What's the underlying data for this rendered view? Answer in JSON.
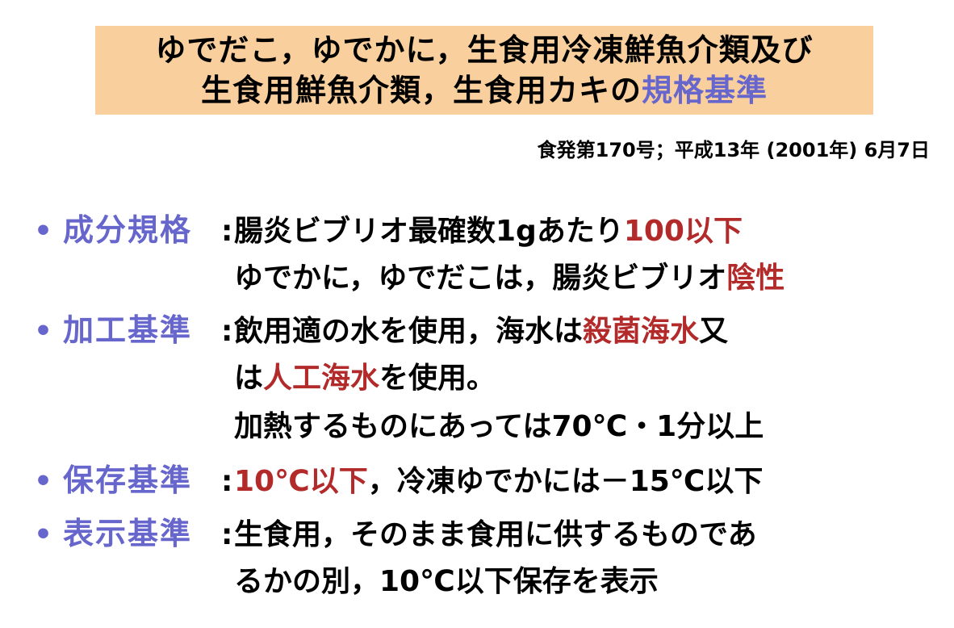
{
  "title": {
    "line1": "ゆでだこ，ゆでかに，生食用冷凍鮮魚介類及び",
    "line2_plain": "生食用鮮魚介類，生食用カキの",
    "line2_highlight": "規格基準"
  },
  "citation": "食発第170号；平成13年 (2001年) 6月7日",
  "bullet_glyph": "•",
  "colon": ":",
  "items": [
    {
      "label": "成分規格",
      "lines": [
        {
          "t1": "腸炎ビブリオ最確数1gあたり",
          "r1": "100以下"
        },
        {
          "t1": "ゆでかに，ゆでだこは，腸炎ビブリオ",
          "r1": "陰性"
        }
      ]
    },
    {
      "label": "加工基準",
      "lines": [
        {
          "t1": "飲用適の水を使用，海水は",
          "r1": "殺菌海水",
          "t2": "又"
        },
        {
          "t1": "は",
          "r1": "人工海水",
          "t2": "を使用。"
        },
        {
          "t1": "加熱するものにあっては70℃・1分以上"
        }
      ]
    },
    {
      "label": "保存基準",
      "lines": [
        {
          "r1": "10℃以下",
          "t2": "，冷凍ゆでかには－15℃以下"
        }
      ]
    },
    {
      "label": "表示基準",
      "lines": [
        {
          "t1": "生食用，そのまま食用に供するものであ"
        },
        {
          "t1": "るかの別，10℃以下保存を表示"
        }
      ]
    }
  ],
  "colors": {
    "title_bg": "#f9cf9d",
    "accent_blue": "#6666cc",
    "highlight_red": "#b22a2a"
  }
}
